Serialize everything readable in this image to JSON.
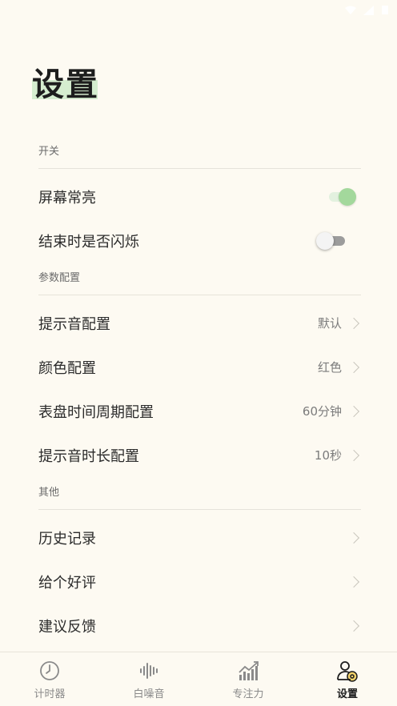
{
  "page": {
    "title": "设置"
  },
  "sections": [
    {
      "header": "开关"
    },
    {
      "header": "参数配置"
    },
    {
      "header": "其他"
    }
  ],
  "switches": [
    {
      "label": "屏幕常亮",
      "on": true
    },
    {
      "label": "结束时是否闪烁",
      "on": false
    }
  ],
  "params": [
    {
      "label": "提示音配置",
      "value": "默认"
    },
    {
      "label": "颜色配置",
      "value": "红色"
    },
    {
      "label": "表盘时间周期配置",
      "value": "60分钟"
    },
    {
      "label": "提示音时长配置",
      "value": "10秒"
    }
  ],
  "others": [
    {
      "label": "历史记录"
    },
    {
      "label": "给个好评"
    },
    {
      "label": "建议反馈"
    }
  ],
  "tabs": [
    {
      "label": "计时器",
      "icon": "clock-icon",
      "active": false
    },
    {
      "label": "白噪音",
      "icon": "sound-wave-icon",
      "active": false
    },
    {
      "label": "专注力",
      "icon": "chart-up-icon",
      "active": false
    },
    {
      "label": "设置",
      "icon": "user-gear-icon",
      "active": true
    }
  ],
  "colors": {
    "accent": "#a3d89c",
    "background": "#fdfaf2",
    "title_highlight": "#d5edcf"
  }
}
